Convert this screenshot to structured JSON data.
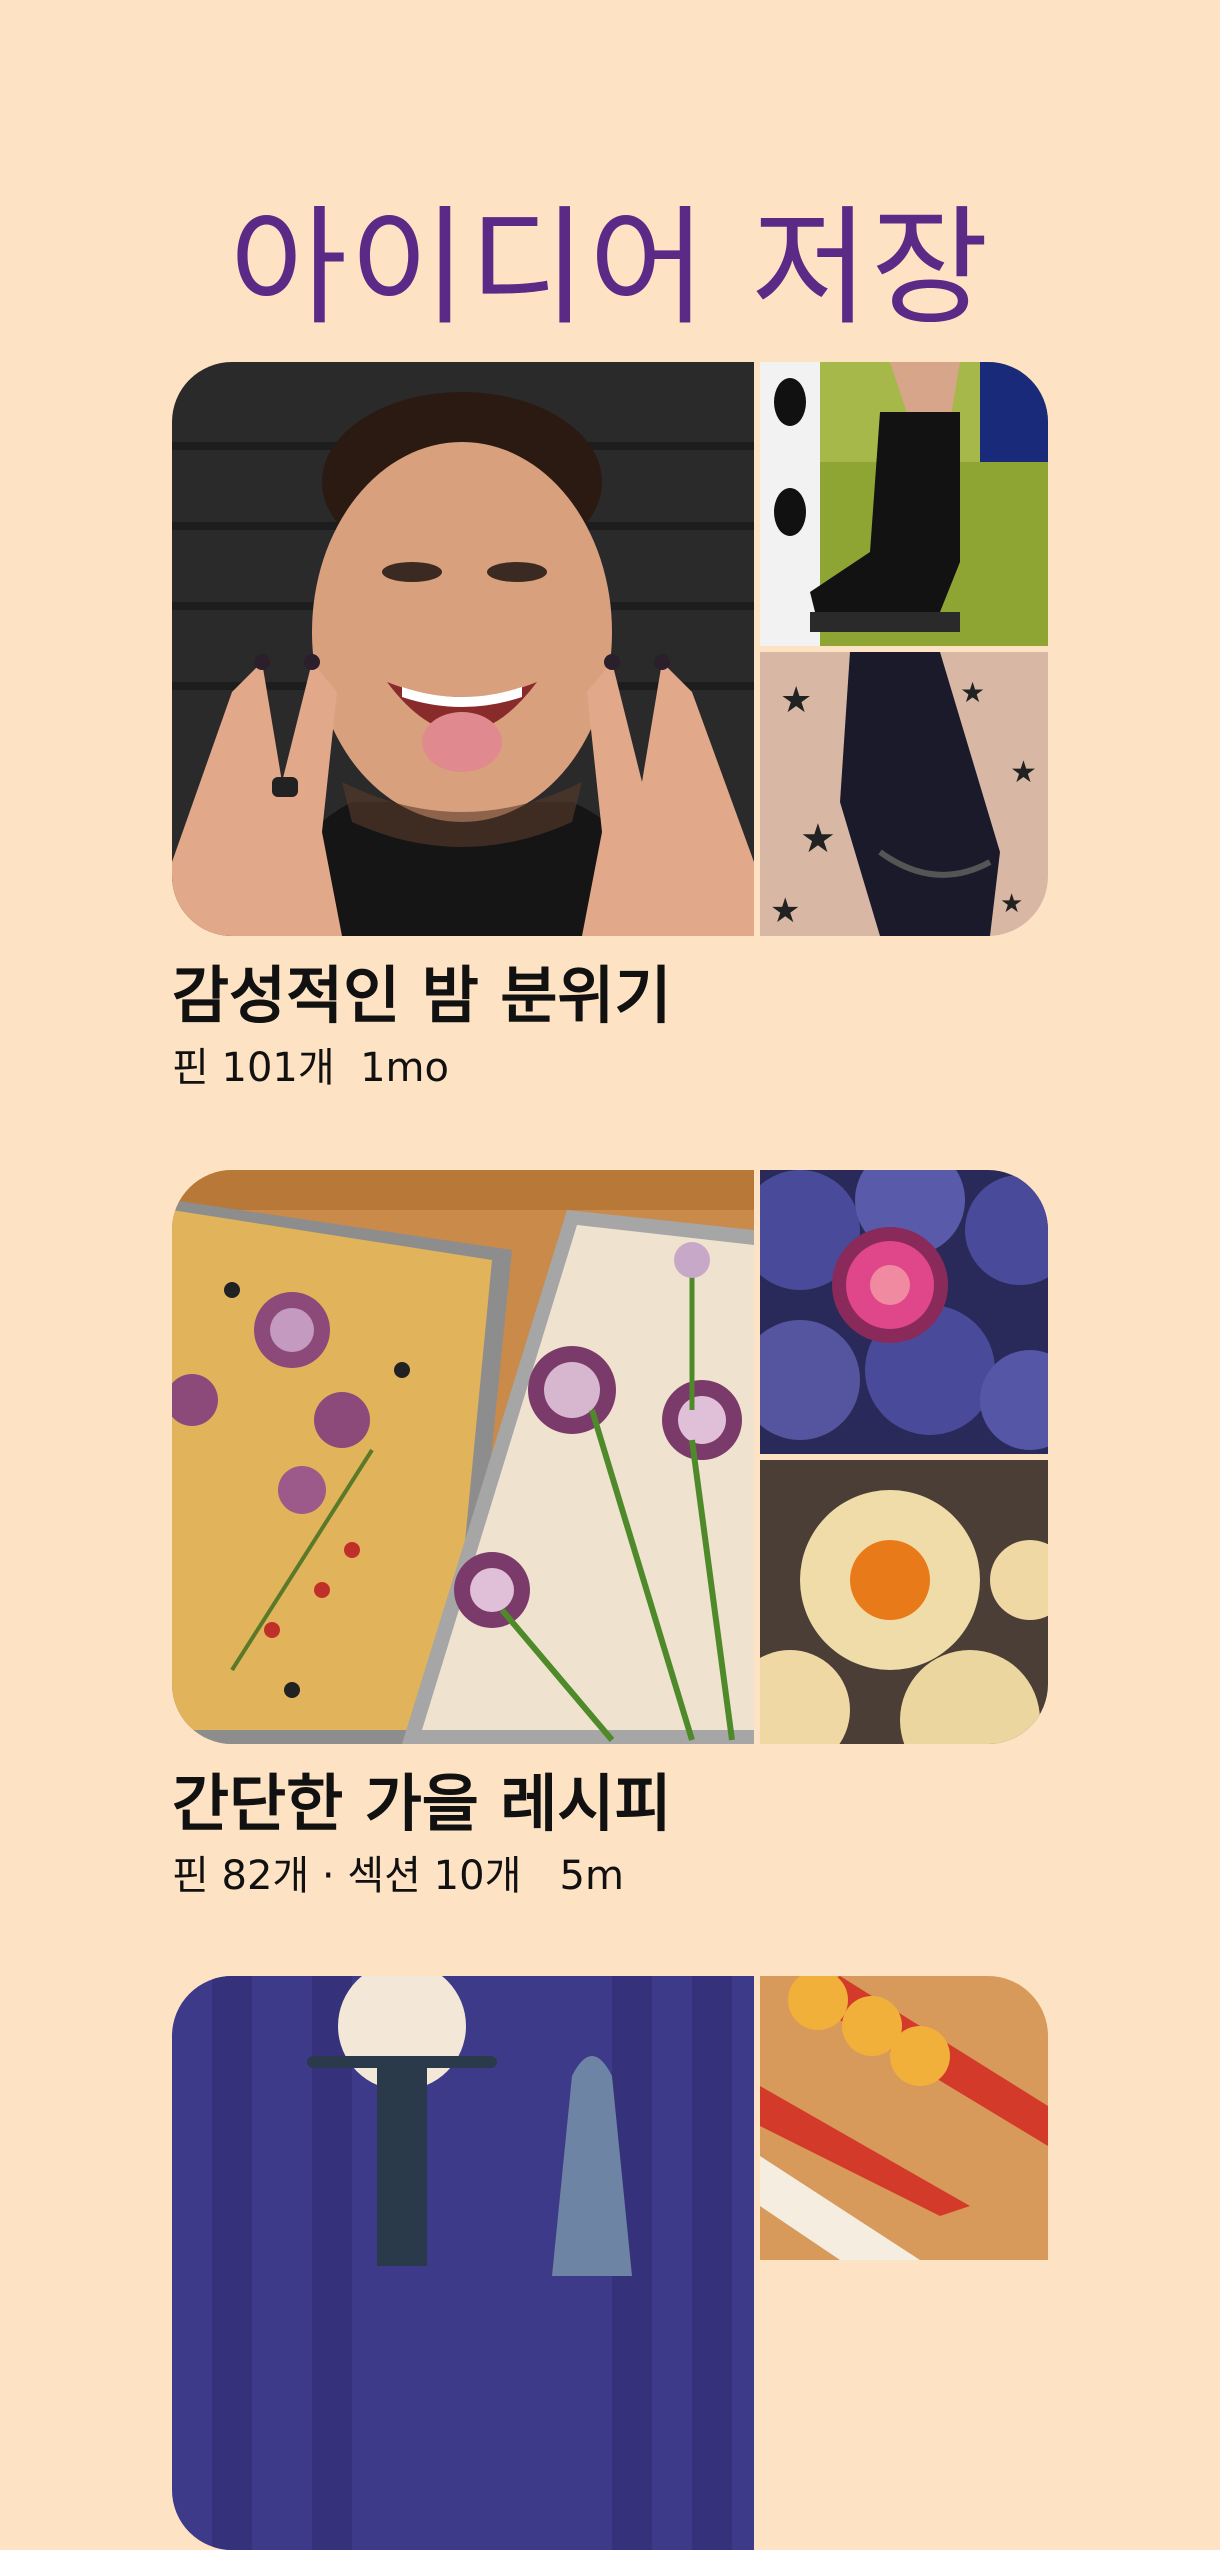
{
  "header": {
    "title": "아이디어 저장"
  },
  "boards": [
    {
      "title": "감성적인 밤 분위기",
      "meta": "핀 101개  1mo",
      "images": [
        "portrait-nail-polish",
        "black-boot-on-green-rug",
        "star-tulle-lace"
      ]
    },
    {
      "title": "간단한 가을 레시피",
      "meta": "핀 82개 · 섹션 10개   5m",
      "images": [
        "focaccia-garden-bread",
        "fresh-figs",
        "ravioli-squash-filling"
      ]
    },
    {
      "title": "",
      "meta": "",
      "images": [
        "lamp-and-vase-purple-room",
        "backgammon-board"
      ]
    }
  ],
  "colors": {
    "background": "#fde2c4",
    "title": "#5b2a86",
    "text": "#111111"
  }
}
